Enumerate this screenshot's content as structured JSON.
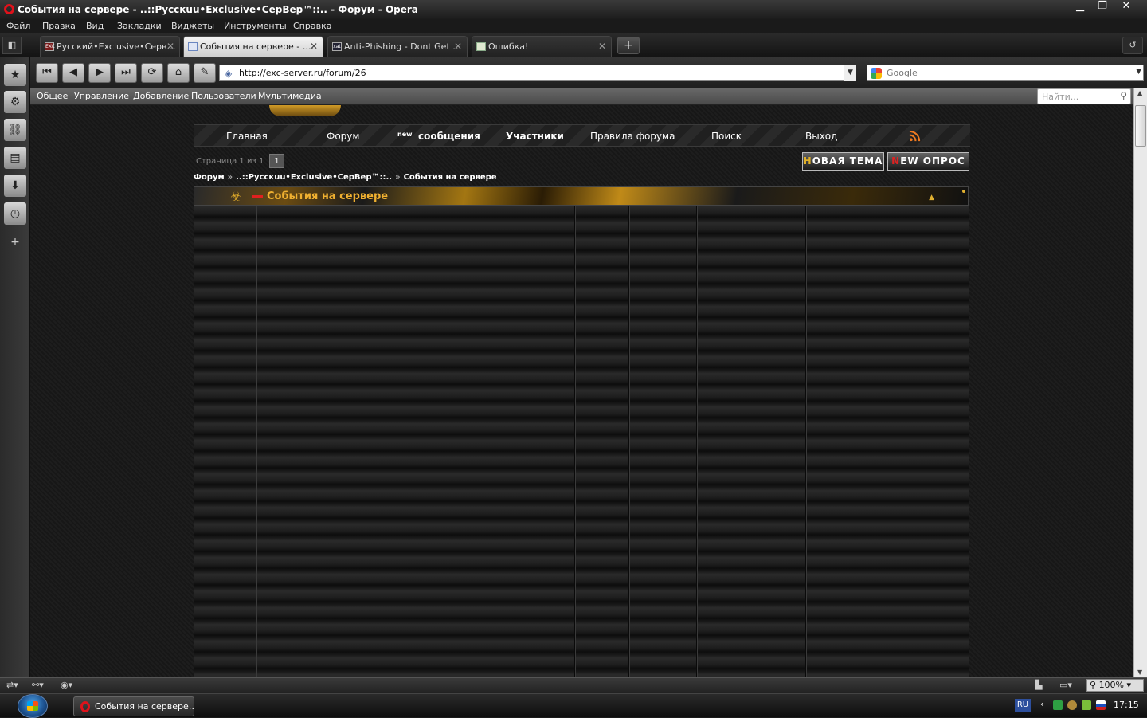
{
  "window": {
    "title": "События на сервере - ..::Pусскuu•Exclusive•СерВер™::.. - Форум - Opera",
    "minimize": "▁",
    "maximize": "❐",
    "close": "✕"
  },
  "menu": [
    "Файл",
    "Правка",
    "Вид",
    "Закладки",
    "Виджеты",
    "Инструменты",
    "Справка"
  ],
  "tabs": [
    {
      "label": "Русский•Exclusive•Серв…",
      "favicon": "EXC",
      "active": false
    },
    {
      "label": "События на сервере - ….",
      "favicon": "",
      "active": true
    },
    {
      "label": "Anti-Phishing - Dont Get …",
      "favicon": "xat",
      "active": false
    },
    {
      "label": "Ошибка!",
      "favicon": "",
      "active": false
    }
  ],
  "tab_close_glyph": "✕",
  "new_tab_glyph": "+",
  "address": {
    "url": "http://exc-server.ru/forum/26",
    "search_engine": "Google"
  },
  "admin_bar": {
    "items": [
      "Общее",
      "Управление",
      "Добавление",
      "Пользователи",
      "Мультимедиа"
    ],
    "search_placeholder": "Найти..."
  },
  "forum_nav": {
    "home": "Главная",
    "forum": "Форум",
    "new_prefix": "new",
    "new_messages": "сообщения",
    "members": "Участники",
    "rules": "Правила форума",
    "search": "Поиск",
    "logout": "Выход"
  },
  "pager": {
    "label": "Страница 1 из 1",
    "current": "1"
  },
  "buttons": {
    "new_topic_first": "Н",
    "new_topic_rest": "ОВАЯ ТЕМА",
    "new_poll_first": "N",
    "new_poll_rest": "EW ОПРОС"
  },
  "breadcrumbs": [
    "Форум",
    "..::Pусскuu•Exclusive•СерВер™::..",
    "События на сервере"
  ],
  "breadcrumb_sep": "»",
  "category": {
    "title": "События на сервере",
    "hazard_glyph": "☣",
    "caret": "▲"
  },
  "statusbar": {
    "zoom": "100%"
  },
  "taskbar": {
    "task_label": "События на сервере…",
    "lang": "RU",
    "time": "17:15"
  },
  "colors": {
    "accent_gold": "#f0b030",
    "opera_red": "#e0121b",
    "rss_orange": "#f07a20"
  },
  "icons": {
    "back": "back-icon",
    "forward": "forward-icon",
    "reload": "reload-icon",
    "home": "home-icon",
    "rss": "rss-icon",
    "search": "search-icon"
  }
}
